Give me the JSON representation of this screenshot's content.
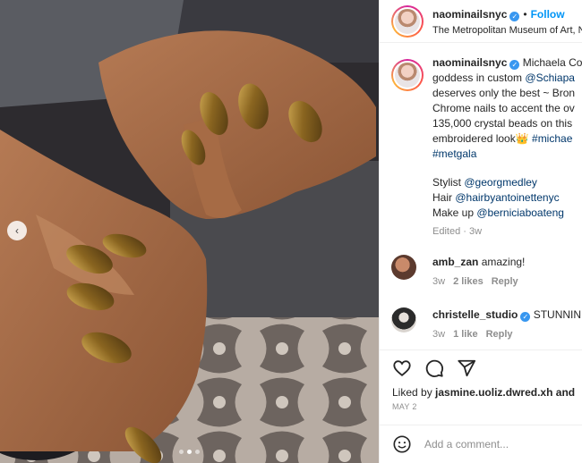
{
  "header": {
    "username": "naominailsnyc",
    "follow_label": "Follow",
    "separator": "•",
    "location": "The Metropolitan Museum of Art, N"
  },
  "caption": {
    "username": "naominailsnyc",
    "lines": [
      "Michaela Co",
      "goddess in custom",
      "@Schiapa",
      "deserves only the best ~ Bron",
      "Chrome nails to accent the ov",
      "135,000 crystal beads on this",
      "embroidered look",
      "#michae",
      "#metgala"
    ],
    "credits": [
      {
        "role": "Stylist",
        "handle": "@georgmedley"
      },
      {
        "role": "Hair",
        "handle": "@hairbyantoinettenyc"
      },
      {
        "role": "Make up",
        "handle": "@berniciaboateng"
      }
    ],
    "meta": "Edited · 3w"
  },
  "comments": [
    {
      "username": "amb_zan",
      "text": "amazing!",
      "time": "3w",
      "likes": "2 likes",
      "reply": "Reply"
    },
    {
      "username": "christelle_studio",
      "text": "STUNNIN",
      "time": "3w",
      "likes": "1 like",
      "reply": "Reply"
    }
  ],
  "liked_by": {
    "prefix": "Liked by",
    "user": "jasmine.uoliz.dwred.xh",
    "suffix": "and"
  },
  "post_date": "MAY 2",
  "add_comment": {
    "placeholder": "Add a comment..."
  },
  "icons": {
    "like": "heart-icon",
    "comment": "comment-bubble-icon",
    "share": "paper-plane-icon",
    "emoji": "emoji-icon",
    "prev": "chevron-left-icon",
    "verified": "verified-badge-icon"
  },
  "colors": {
    "accent": "#0095f6",
    "link": "#00376b",
    "muted": "#8e8e8e",
    "verified": "#3897f0"
  },
  "carousel": {
    "slides": 3,
    "active": 1
  }
}
